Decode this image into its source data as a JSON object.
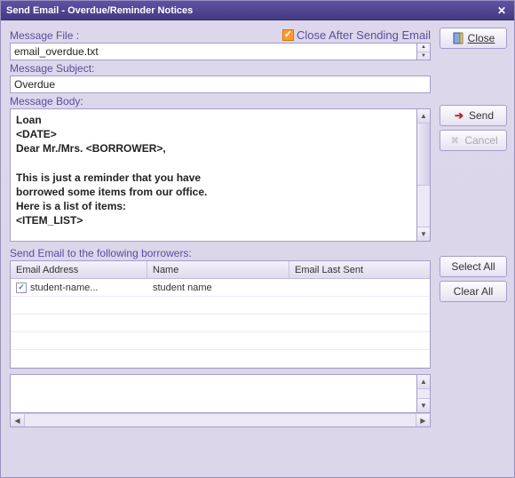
{
  "window": {
    "title": "Send Email - Overdue/Reminder Notices"
  },
  "options": {
    "close_after_send_label": "Close After Sending Email",
    "close_after_send_checked": true
  },
  "labels": {
    "message_file": "Message File :",
    "message_subject": "Message Subject:",
    "message_body": "Message Body:",
    "send_to": "Send Email to the following borrowers:"
  },
  "message": {
    "file": "email_overdue.txt",
    "subject": "Overdue",
    "body": "Loan\n<DATE>\nDear Mr./Mrs. <BORROWER>,\n\nThis is just a reminder that you have\nborrowed some items from our office.\nHere is a list of items:\n<ITEM_LIST>"
  },
  "table": {
    "headers": {
      "email": "Email Address",
      "name": "Name",
      "last_sent": "Email Last Sent"
    },
    "rows": [
      {
        "checked": true,
        "email": "student-name...",
        "name": "student name",
        "last_sent": ""
      }
    ]
  },
  "buttons": {
    "close": "Close",
    "send": "Send",
    "cancel": "Cancel",
    "select_all": "Select All",
    "clear_all": "Clear All"
  }
}
